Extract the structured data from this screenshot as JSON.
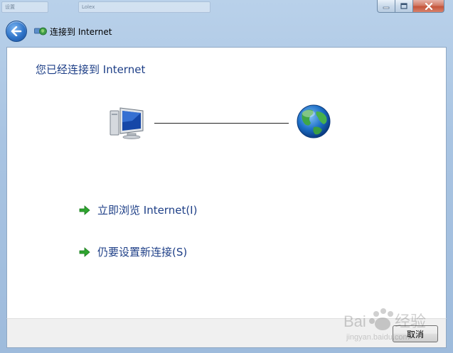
{
  "window": {
    "title": "连接到 Internet",
    "background_tabs": [
      "设置",
      "Lolex"
    ],
    "accent": "#1e3f87"
  },
  "icons": {
    "back": "back-arrow-icon",
    "wizard": "network-wizard-icon",
    "computer": "computer-icon",
    "globe": "globe-icon",
    "link_arrow": "green-arrow-icon",
    "minimize": "minimize-icon",
    "maximize": "maximize-icon",
    "close": "close-icon"
  },
  "main": {
    "heading": "您已经连接到 Internet",
    "links": [
      {
        "label": "立即浏览 Internet(I)"
      },
      {
        "label": "仍要设置新连接(S)"
      }
    ]
  },
  "footer": {
    "cancel_label": "取消"
  },
  "watermark": {
    "brand": "Baidu 经验",
    "url": "jingyan.baidu.com"
  }
}
